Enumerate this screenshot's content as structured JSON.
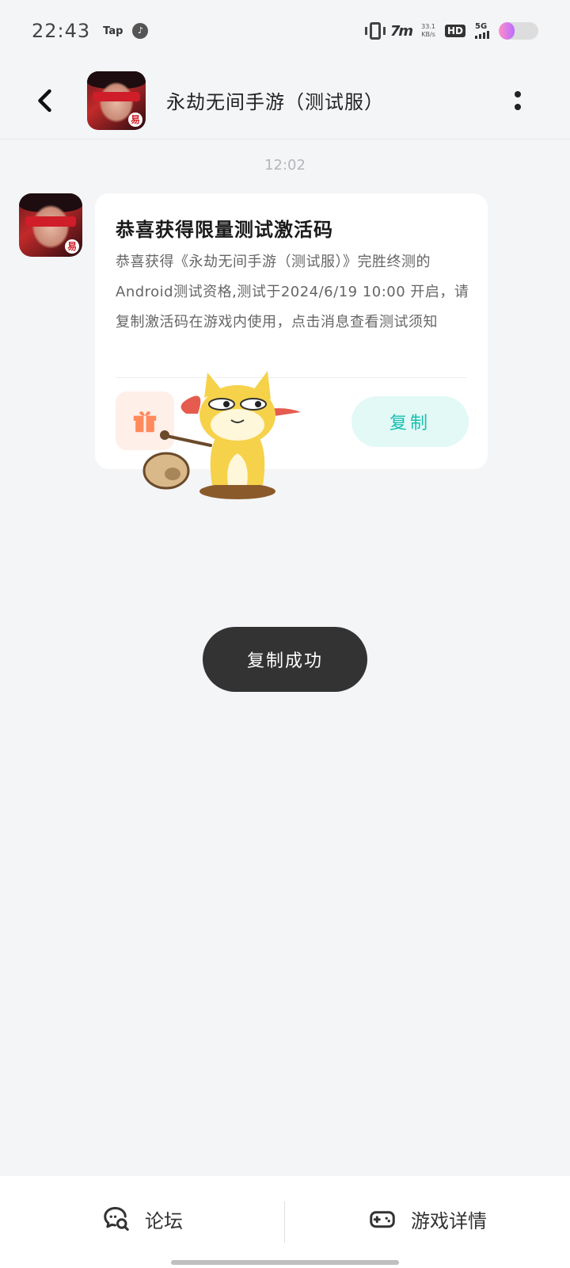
{
  "status_bar": {
    "time": "22:43",
    "app_label": "Tap",
    "net_speed_value": "33.1",
    "net_speed_unit": "KB/s",
    "hd_label": "HD",
    "network_label": "5G",
    "battery_level": 0.4,
    "battery_color": "#c77dff"
  },
  "header": {
    "title": "永劫无间手游（测试服）",
    "back_icon": "chevron-left-icon",
    "more_icon": "more-vertical-icon"
  },
  "message": {
    "time": "12:02",
    "title": "恭喜获得限量测试激活码",
    "body": "恭喜获得《永劫无间手游（测试服）》完胜终测的Android测试资格,测试于2024/6/19 10:00 开启，请复制激活码在游戏内使用，点击消息查看测试须知",
    "gift_icon": "gift-icon",
    "copy_label": "复制",
    "accent_color": "#18bfb0"
  },
  "toast": {
    "text": "复制成功"
  },
  "bottom_nav": {
    "forum_label": "论坛",
    "forum_icon": "chat-search-icon",
    "details_label": "游戏详情",
    "details_icon": "gamepad-icon"
  }
}
